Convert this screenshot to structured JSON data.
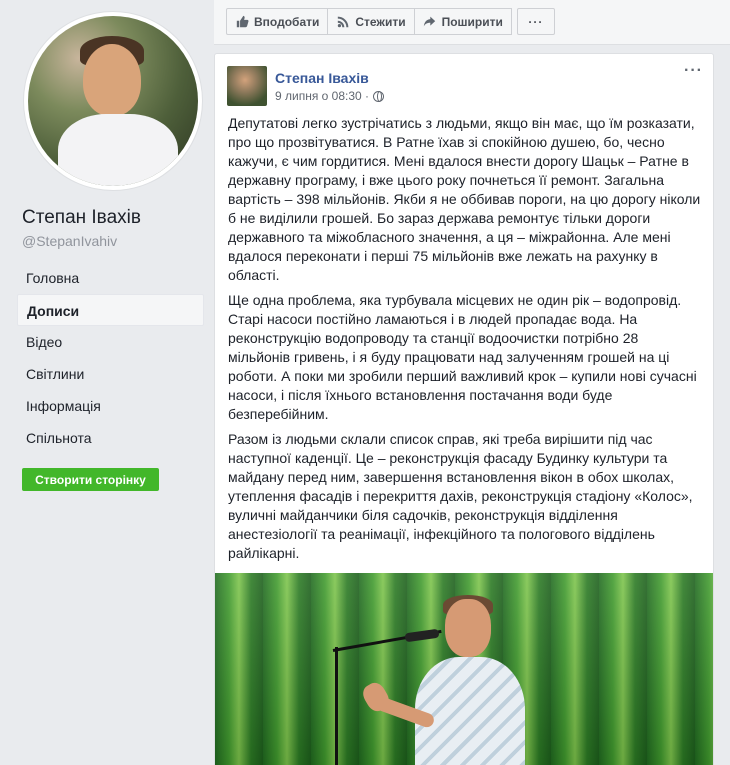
{
  "profile": {
    "name": "Степан Івахів",
    "handle": "@StepanIvahiv"
  },
  "nav": {
    "items": [
      {
        "label": "Головна"
      },
      {
        "label": "Дописи"
      },
      {
        "label": "Відео"
      },
      {
        "label": "Світлини"
      },
      {
        "label": "Інформація"
      },
      {
        "label": "Спільнота"
      }
    ],
    "active": "Дописи",
    "create_page_label": "Створити сторінку"
  },
  "action_bar": {
    "like_label": "Вподобати",
    "like_icon": "thumbs-up-icon",
    "follow_label": "Стежити",
    "follow_icon": "rss-icon",
    "share_label": "Поширити",
    "share_icon": "share-arrow-icon",
    "more_label": "···"
  },
  "post": {
    "author": "Степан Івахів",
    "date": "9 липня о 08:30 · ",
    "privacy_icon": "globe-icon",
    "more_label": "···",
    "paragraphs": [
      "Депутатові легко зустрічатись з людьми, якщо він має, що їм розказати, про що прозвітуватися. В Ратне їхав зі спокійною душею, бо, чесно кажучи, є чим гордитися. Мені вдалося внести дорогу Шацьк – Ратне в державну програму, і вже цього року почнеться її ремонт. Загальна вартість – 398 мільйонів. Якби я не оббивав пороги, на цю дорогу ніколи б не виділили грошей. Бо зараз держава ремонтує тільки дороги державного та міжобласного значення, а ця – міжрайонна. Але мені вдалося переконати і перші 75 мільйонів вже лежать на рахунку в області.",
      "Ще одна проблема, яка турбувала місцевих не один рік – водопровід. Старі насоси постійно ламаються і в людей пропадає вода. На реконструкцію водопроводу та станції водоочистки потрібно 28 мільйонів гривень, і я буду працювати над залученням грошей на ці роботи. А поки ми зробили перший важливий крок – купили нові сучасні насоси, і після їхнього встановлення постачання води буде безперебійним.",
      "Разом із людьми склали список справ, які треба вирішити під час наступної каденції. Це – реконструкція фасаду Будинку культури та майдану перед ним, завершення встановлення вікон в обох школах, утеплення фасадів і перекриття дахів, реконструкція стадіону «Колос», вуличні майданчики біля садочків, реконструкція відділення анестезіології та реанімації, інфекційного та пологового відділень райлікарні."
    ]
  },
  "colors": {
    "link": "#385898",
    "create_button": "#42b72a",
    "background": "#e9ebee"
  }
}
